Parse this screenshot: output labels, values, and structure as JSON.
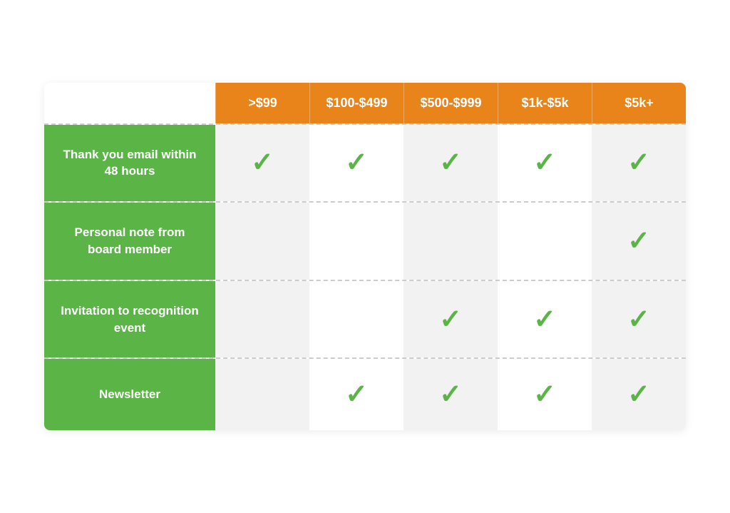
{
  "header": {
    "empty": "",
    "columns": [
      {
        "id": "col1",
        "label": ">$99"
      },
      {
        "id": "col2",
        "label": "$100-$499"
      },
      {
        "id": "col3",
        "label": "$500-$999"
      },
      {
        "id": "col4",
        "label": "$1k-$5k"
      },
      {
        "id": "col5",
        "label": "$5k+"
      }
    ]
  },
  "rows": [
    {
      "id": "row1",
      "label": "Thank you email within 48 hours",
      "checks": [
        true,
        true,
        true,
        true,
        true
      ]
    },
    {
      "id": "row2",
      "label": "Personal note from board member",
      "checks": [
        false,
        false,
        false,
        false,
        true
      ]
    },
    {
      "id": "row3",
      "label": "Invitation to recognition event",
      "checks": [
        false,
        false,
        true,
        true,
        true
      ]
    },
    {
      "id": "row4",
      "label": "Newsletter",
      "checks": [
        false,
        true,
        true,
        true,
        true
      ]
    }
  ],
  "checkmark_symbol": "✓",
  "colors": {
    "header_bg": "#e8841a",
    "label_bg": "#5ab446",
    "check_color": "#5ab446",
    "cell_light": "#ebebeb",
    "cell_white": "#f8f8f8"
  }
}
